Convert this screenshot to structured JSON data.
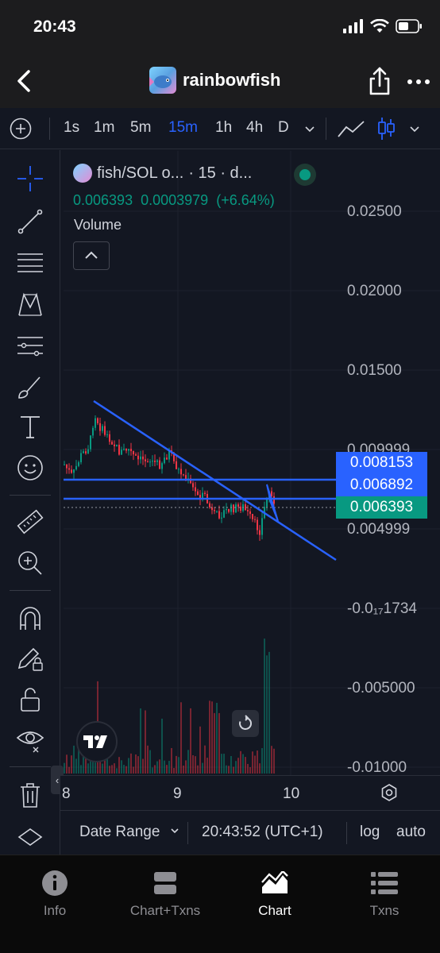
{
  "status_bar": {
    "time": "20:43"
  },
  "nav": {
    "title": "rainbowfish"
  },
  "toolbar": {
    "timeframes": [
      "1s",
      "1m",
      "5m",
      "15m",
      "1h",
      "4h",
      "D"
    ],
    "active_timeframe": "15m"
  },
  "legend": {
    "symbol": "fish/SOL o...",
    "interval": "· 15 · d...",
    "close": "0.006393",
    "change": "0.0003979",
    "change_pct": "(+6.64%)",
    "volume_label": "Volume"
  },
  "price_axis": {
    "labels": [
      "0.02500",
      "0.02000",
      "0.01500",
      "0.009999",
      "0.004999",
      "-0.0₁₇1734",
      "-0.005000",
      "-0.01000"
    ]
  },
  "price_tags": {
    "line_1": "0.008153",
    "line_2": "0.006892",
    "last": "0.006393"
  },
  "time_axis": {
    "labels": [
      "8",
      "9",
      "10"
    ]
  },
  "bottom_bar": {
    "date_range": "Date Range",
    "clock": "20:43:52 (UTC+1)",
    "log": "log",
    "auto": "auto"
  },
  "tabbar": {
    "tabs": [
      {
        "label": "Info",
        "icon": "info-icon"
      },
      {
        "label": "Chart+Txns",
        "icon": "split-view-icon"
      },
      {
        "label": "Chart",
        "icon": "chart-icon"
      },
      {
        "label": "Txns",
        "icon": "list-icon"
      }
    ],
    "active": "Chart"
  },
  "colors": {
    "up": "#089981",
    "down": "#f23645",
    "accent": "#2962ff",
    "trendline": "#2962ff",
    "tag_blue": "#2962ff",
    "tag_green": "#089981"
  }
}
